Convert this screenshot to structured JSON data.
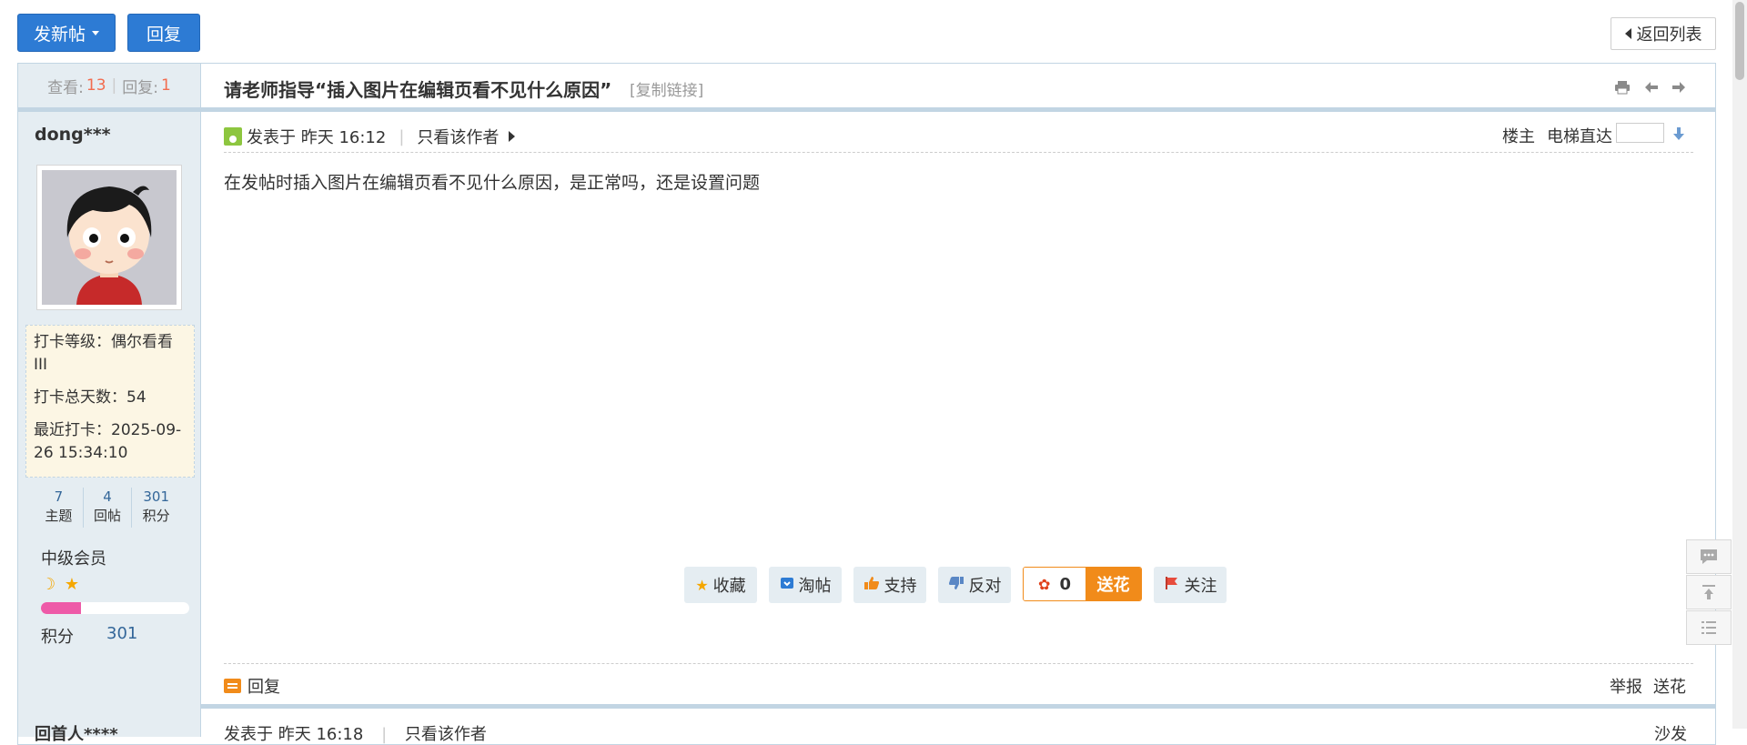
{
  "toolbar": {
    "new_post_label": "发新帖",
    "reply_label": "回复",
    "back_label": "返回列表"
  },
  "thread": {
    "views_label": "查看:",
    "views": "13",
    "replies_label": "回复:",
    "replies": "1",
    "separator": "|",
    "title": "请老师指导“插入图片在编辑页看不见什么原因”",
    "copy_link": "[复制链接]"
  },
  "author": {
    "name": "dong***",
    "checkin_level": "打卡等级：偶尔看看III",
    "checkin_days": "打卡总天数：54",
    "last_checkin": "最近打卡：2025-09-26 15:34:10",
    "stats": [
      {
        "value": "7",
        "label": "主题"
      },
      {
        "value": "4",
        "label": "回帖"
      },
      {
        "value": "301",
        "label": "积分"
      }
    ],
    "group": "中级会员",
    "progress": 0.27,
    "points_label": "积分",
    "points_value": "301"
  },
  "post": {
    "posted_at": "发表于 昨天 16:12",
    "only_author": "只看该作者",
    "floor": "楼主",
    "elevator": "电梯直达",
    "content": "在发帖时插入图片在编辑页看不见什么原因，是正常吗，还是设置问题",
    "actions": {
      "favorite": "收藏",
      "taobao": "淘帖",
      "support": "支持",
      "oppose": "反对",
      "flower_count": "0",
      "send_flower": "送花",
      "follow": "关注"
    },
    "reply": "回复",
    "report": "举报",
    "gift": "送花"
  },
  "next_post": {
    "name": "回首人****",
    "posted_at": "发表于 昨天 16:18",
    "only_author": "只看该作者",
    "floor": "沙发"
  },
  "colors": {
    "accent": "#2d7bd4",
    "sidebar": "#e5edf2",
    "border": "#c2d5e3",
    "orange": "#f18b1a",
    "highlight": "#f26c4f"
  }
}
